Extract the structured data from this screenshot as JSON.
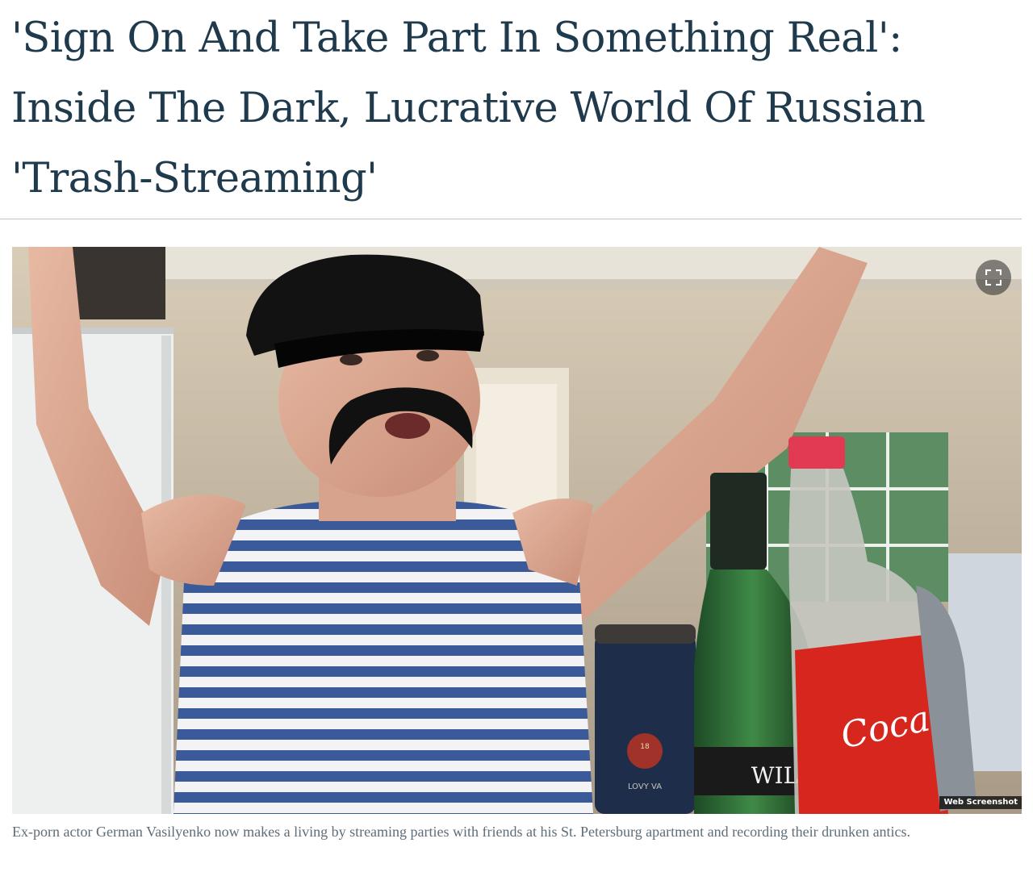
{
  "article": {
    "headline": "'Sign On And Take Part In Something Real': Inside The Dark, Lucrative World Of Russian 'Trash-Streaming'"
  },
  "figure": {
    "credit": "Web Screenshot",
    "expand_icon": "fullscreen-expand-icon",
    "caption": "Ex-porn actor German Vasilyenko now makes a living by streaming parties with friends at his St. Petersburg apartment and recording their drunken antics.",
    "photo_text": {
      "bottle_label": "WIL",
      "cola_label": "Coca",
      "vodka_label": "LOVY VA",
      "seal_text": "18"
    }
  },
  "colors": {
    "headline": "#1e3a4c",
    "caption": "#5e6d78",
    "rule": "#b9c4cb",
    "stripe_blue": "#3b5a9a",
    "cola_red": "#d7261e"
  }
}
